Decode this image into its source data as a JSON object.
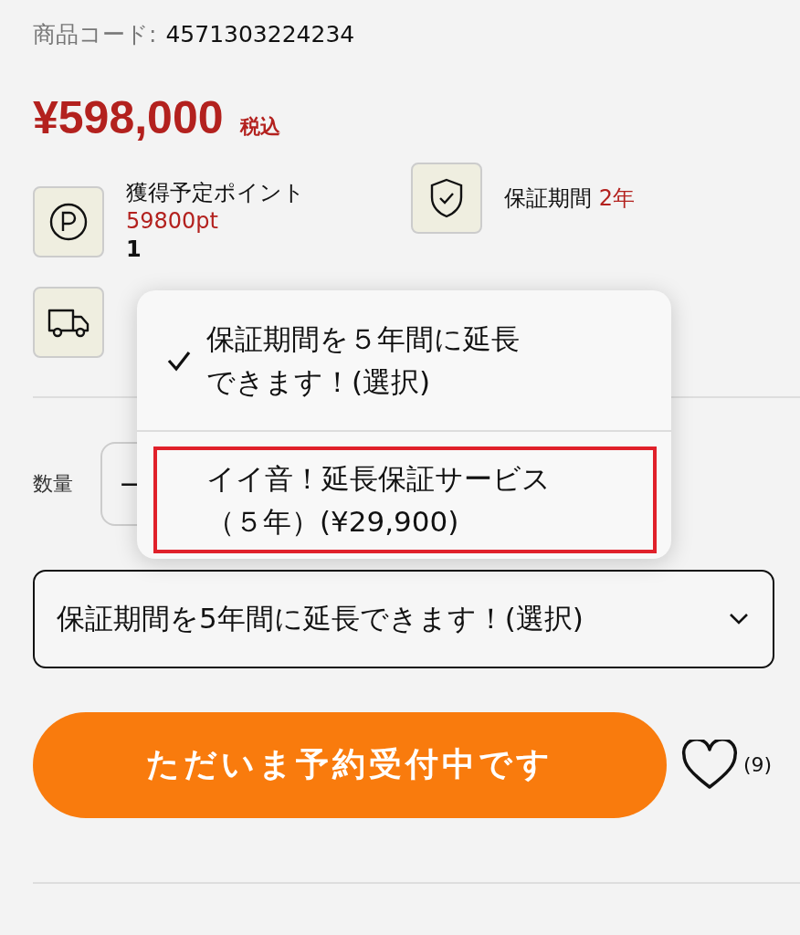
{
  "product_code": {
    "label": "商品コード:",
    "value": "4571303224234"
  },
  "price": {
    "amount": "¥598,000",
    "tax_note": "税込"
  },
  "info": [
    {
      "kind": "points",
      "title": "獲得予定ポイント",
      "value": "59800pt",
      "note": "1"
    },
    {
      "kind": "warranty",
      "title": "保証期間",
      "value": "2年"
    },
    {
      "kind": "shipping"
    }
  ],
  "quantity": {
    "label": "数量",
    "minus": "−"
  },
  "warranty_select": {
    "value": "保証期間を5年間に延長できます！(選択)",
    "expanded": true,
    "options": [
      {
        "lines": [
          "保証期間を５年間に延長",
          "できます！(選択)"
        ],
        "selected": true,
        "highlighted": false
      },
      {
        "lines": [
          "イイ音！延長保証サービス",
          "（５年）(¥29,900)"
        ],
        "selected": false,
        "highlighted": true
      }
    ]
  },
  "reserve_button": "ただいま予約受付中です",
  "favorite": {
    "count": "(9)"
  }
}
